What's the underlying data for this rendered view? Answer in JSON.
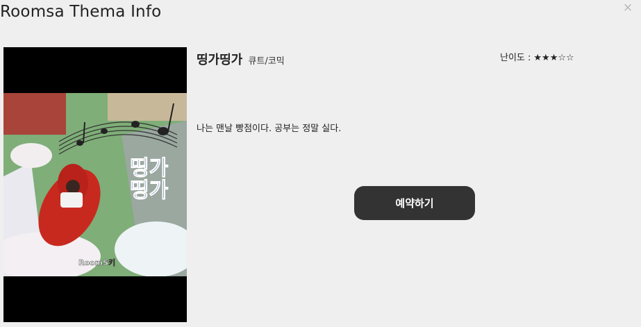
{
  "modal": {
    "title": "Roomsa Thema Info",
    "close_symbol": "×"
  },
  "theme": {
    "name": "띵가띵가",
    "genre": "큐트/코믹",
    "difficulty_label": "난이도 :",
    "difficulty_stars": "★★★☆☆",
    "difficulty_rating": 3,
    "difficulty_max": 5,
    "description": "나는 맨날 빵점이다. 공부는 정말 실다.",
    "reserve_label": "예약하기",
    "poster": {
      "title_line1": "띵가",
      "title_line2": "띵가",
      "logo": "RoomS키"
    }
  },
  "colors": {
    "background": "#efefef",
    "button": "#333333",
    "button_text": "#ffffff",
    "close_icon": "#b4b4b4"
  },
  "icons": {
    "close": "close-icon",
    "star": "star-icon"
  }
}
